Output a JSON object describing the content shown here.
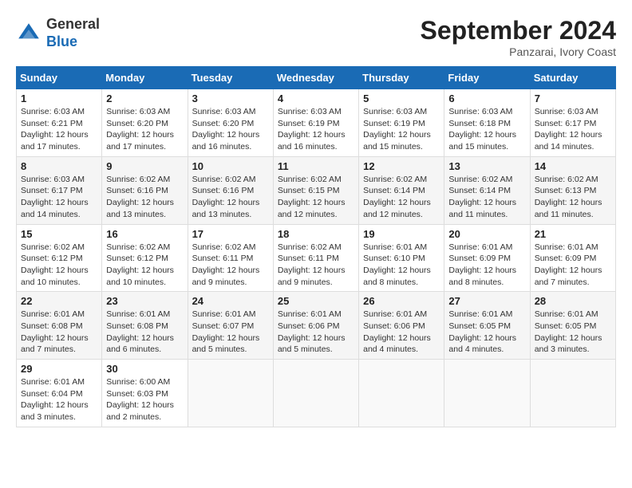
{
  "header": {
    "logo": {
      "line1": "General",
      "line2": "Blue"
    },
    "title": "September 2024",
    "location": "Panzarai, Ivory Coast"
  },
  "calendar": {
    "weekdays": [
      "Sunday",
      "Monday",
      "Tuesday",
      "Wednesday",
      "Thursday",
      "Friday",
      "Saturday"
    ],
    "weeks": [
      [
        {
          "day": "",
          "info": ""
        },
        {
          "day": "",
          "info": ""
        },
        {
          "day": "",
          "info": ""
        },
        {
          "day": "",
          "info": ""
        },
        {
          "day": "5",
          "info": "Sunrise: 6:03 AM\nSunset: 6:19 PM\nDaylight: 12 hours\nand 15 minutes."
        },
        {
          "day": "6",
          "info": "Sunrise: 6:03 AM\nSunset: 6:18 PM\nDaylight: 12 hours\nand 15 minutes."
        },
        {
          "day": "7",
          "info": "Sunrise: 6:03 AM\nSunset: 6:17 PM\nDaylight: 12 hours\nand 14 minutes."
        }
      ],
      [
        {
          "day": "1",
          "info": "Sunrise: 6:03 AM\nSunset: 6:21 PM\nDaylight: 12 hours\nand 17 minutes."
        },
        {
          "day": "2",
          "info": "Sunrise: 6:03 AM\nSunset: 6:20 PM\nDaylight: 12 hours\nand 17 minutes."
        },
        {
          "day": "3",
          "info": "Sunrise: 6:03 AM\nSunset: 6:20 PM\nDaylight: 12 hours\nand 16 minutes."
        },
        {
          "day": "4",
          "info": "Sunrise: 6:03 AM\nSunset: 6:19 PM\nDaylight: 12 hours\nand 16 minutes."
        },
        {
          "day": "",
          "info": ""
        },
        {
          "day": "",
          "info": ""
        },
        {
          "day": "",
          "info": ""
        }
      ],
      [
        {
          "day": "8",
          "info": "Sunrise: 6:03 AM\nSunset: 6:17 PM\nDaylight: 12 hours\nand 14 minutes."
        },
        {
          "day": "9",
          "info": "Sunrise: 6:02 AM\nSunset: 6:16 PM\nDaylight: 12 hours\nand 13 minutes."
        },
        {
          "day": "10",
          "info": "Sunrise: 6:02 AM\nSunset: 6:16 PM\nDaylight: 12 hours\nand 13 minutes."
        },
        {
          "day": "11",
          "info": "Sunrise: 6:02 AM\nSunset: 6:15 PM\nDaylight: 12 hours\nand 12 minutes."
        },
        {
          "day": "12",
          "info": "Sunrise: 6:02 AM\nSunset: 6:14 PM\nDaylight: 12 hours\nand 12 minutes."
        },
        {
          "day": "13",
          "info": "Sunrise: 6:02 AM\nSunset: 6:14 PM\nDaylight: 12 hours\nand 11 minutes."
        },
        {
          "day": "14",
          "info": "Sunrise: 6:02 AM\nSunset: 6:13 PM\nDaylight: 12 hours\nand 11 minutes."
        }
      ],
      [
        {
          "day": "15",
          "info": "Sunrise: 6:02 AM\nSunset: 6:12 PM\nDaylight: 12 hours\nand 10 minutes."
        },
        {
          "day": "16",
          "info": "Sunrise: 6:02 AM\nSunset: 6:12 PM\nDaylight: 12 hours\nand 10 minutes."
        },
        {
          "day": "17",
          "info": "Sunrise: 6:02 AM\nSunset: 6:11 PM\nDaylight: 12 hours\nand 9 minutes."
        },
        {
          "day": "18",
          "info": "Sunrise: 6:02 AM\nSunset: 6:11 PM\nDaylight: 12 hours\nand 9 minutes."
        },
        {
          "day": "19",
          "info": "Sunrise: 6:01 AM\nSunset: 6:10 PM\nDaylight: 12 hours\nand 8 minutes."
        },
        {
          "day": "20",
          "info": "Sunrise: 6:01 AM\nSunset: 6:09 PM\nDaylight: 12 hours\nand 8 minutes."
        },
        {
          "day": "21",
          "info": "Sunrise: 6:01 AM\nSunset: 6:09 PM\nDaylight: 12 hours\nand 7 minutes."
        }
      ],
      [
        {
          "day": "22",
          "info": "Sunrise: 6:01 AM\nSunset: 6:08 PM\nDaylight: 12 hours\nand 7 minutes."
        },
        {
          "day": "23",
          "info": "Sunrise: 6:01 AM\nSunset: 6:08 PM\nDaylight: 12 hours\nand 6 minutes."
        },
        {
          "day": "24",
          "info": "Sunrise: 6:01 AM\nSunset: 6:07 PM\nDaylight: 12 hours\nand 5 minutes."
        },
        {
          "day": "25",
          "info": "Sunrise: 6:01 AM\nSunset: 6:06 PM\nDaylight: 12 hours\nand 5 minutes."
        },
        {
          "day": "26",
          "info": "Sunrise: 6:01 AM\nSunset: 6:06 PM\nDaylight: 12 hours\nand 4 minutes."
        },
        {
          "day": "27",
          "info": "Sunrise: 6:01 AM\nSunset: 6:05 PM\nDaylight: 12 hours\nand 4 minutes."
        },
        {
          "day": "28",
          "info": "Sunrise: 6:01 AM\nSunset: 6:05 PM\nDaylight: 12 hours\nand 3 minutes."
        }
      ],
      [
        {
          "day": "29",
          "info": "Sunrise: 6:01 AM\nSunset: 6:04 PM\nDaylight: 12 hours\nand 3 minutes."
        },
        {
          "day": "30",
          "info": "Sunrise: 6:00 AM\nSunset: 6:03 PM\nDaylight: 12 hours\nand 2 minutes."
        },
        {
          "day": "",
          "info": ""
        },
        {
          "day": "",
          "info": ""
        },
        {
          "day": "",
          "info": ""
        },
        {
          "day": "",
          "info": ""
        },
        {
          "day": "",
          "info": ""
        }
      ]
    ]
  }
}
